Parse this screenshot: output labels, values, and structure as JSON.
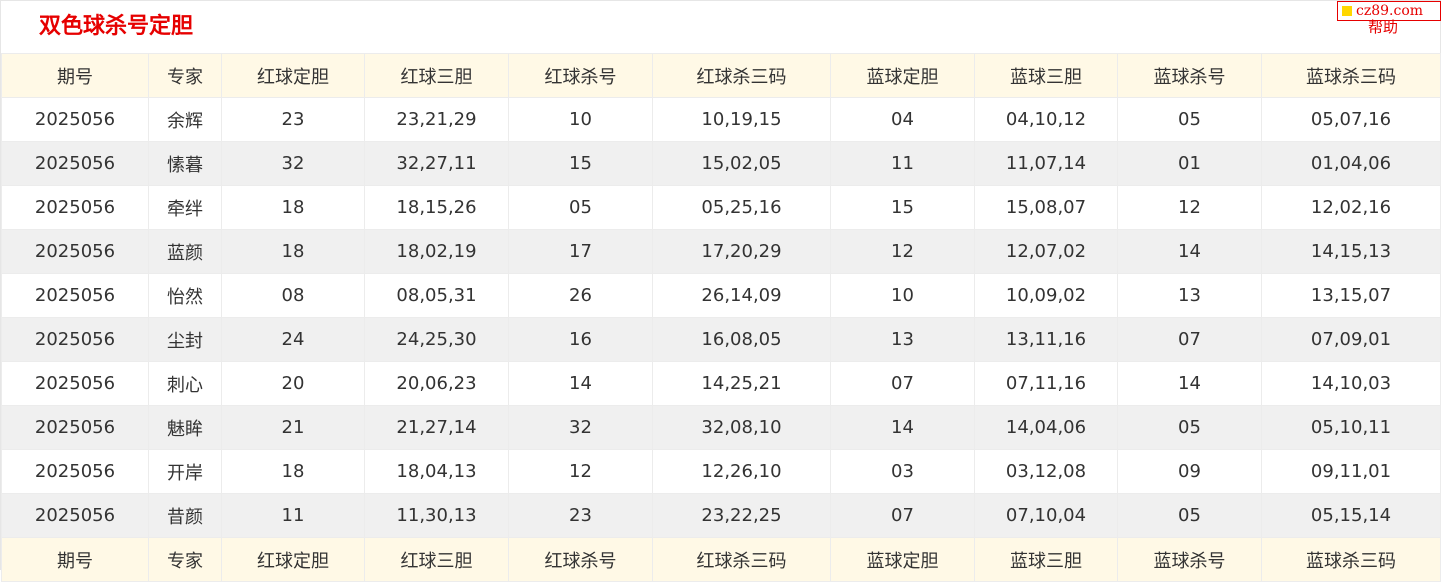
{
  "header": {
    "title": "双色球杀号定胆",
    "badge_text": "cz89.com",
    "help_label": "帮助"
  },
  "colors": {
    "accent": "#e60000",
    "header_bg": "#fff9e6",
    "stripe_bg": "#f0f0f0",
    "badge_square": "#ffd700"
  },
  "table": {
    "columns": [
      "期号",
      "专家",
      "红球定胆",
      "红球三胆",
      "红球杀号",
      "红球杀三码",
      "蓝球定胆",
      "蓝球三胆",
      "蓝球杀号",
      "蓝球杀三码"
    ],
    "rows": [
      [
        "2025056",
        "余辉",
        "23",
        "23,21,29",
        "10",
        "10,19,15",
        "04",
        "04,10,12",
        "05",
        "05,07,16"
      ],
      [
        "2025056",
        "愫暮",
        "32",
        "32,27,11",
        "15",
        "15,02,05",
        "11",
        "11,07,14",
        "01",
        "01,04,06"
      ],
      [
        "2025056",
        "牵绊",
        "18",
        "18,15,26",
        "05",
        "05,25,16",
        "15",
        "15,08,07",
        "12",
        "12,02,16"
      ],
      [
        "2025056",
        "蓝颜",
        "18",
        "18,02,19",
        "17",
        "17,20,29",
        "12",
        "12,07,02",
        "14",
        "14,15,13"
      ],
      [
        "2025056",
        "怡然",
        "08",
        "08,05,31",
        "26",
        "26,14,09",
        "10",
        "10,09,02",
        "13",
        "13,15,07"
      ],
      [
        "2025056",
        "尘封",
        "24",
        "24,25,30",
        "16",
        "16,08,05",
        "13",
        "13,11,16",
        "07",
        "07,09,01"
      ],
      [
        "2025056",
        "刺心",
        "20",
        "20,06,23",
        "14",
        "14,25,21",
        "07",
        "07,11,16",
        "14",
        "14,10,03"
      ],
      [
        "2025056",
        "魅眸",
        "21",
        "21,27,14",
        "32",
        "32,08,10",
        "14",
        "14,04,06",
        "05",
        "05,10,11"
      ],
      [
        "2025056",
        "开岸",
        "18",
        "18,04,13",
        "12",
        "12,26,10",
        "03",
        "03,12,08",
        "09",
        "09,11,01"
      ],
      [
        "2025056",
        "昔颜",
        "11",
        "11,30,13",
        "23",
        "23,22,25",
        "07",
        "07,10,04",
        "05",
        "05,15,14"
      ]
    ]
  }
}
